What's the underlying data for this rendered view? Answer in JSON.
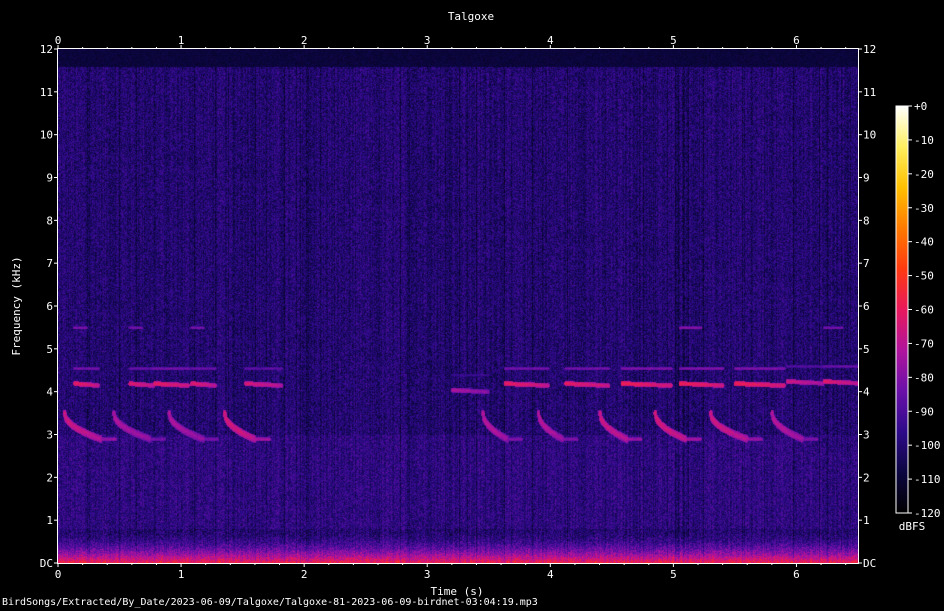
{
  "chart_data": {
    "type": "heatmap",
    "title": "Talgoxe",
    "xlabel": "Time (s)",
    "ylabel": "Frequency (kHz)",
    "xlim": [
      0,
      6.5
    ],
    "ylim": [
      0,
      12
    ],
    "x_ticks": [
      "0",
      "1",
      "2",
      "3",
      "4",
      "5",
      "6"
    ],
    "y_ticks": [
      "DC",
      "1",
      "2",
      "3",
      "4",
      "5",
      "6",
      "7",
      "8",
      "9",
      "10",
      "11",
      "12"
    ],
    "colorbar": {
      "label": "dBFS",
      "range": [
        -120,
        0
      ],
      "ticks": [
        "+0",
        "-10",
        "-20",
        "-30",
        "-40",
        "-50",
        "-60",
        "-70",
        "-80",
        "-90",
        "-100",
        "-110",
        "-120"
      ],
      "colors": [
        "#000000",
        "#0b0640",
        "#2e0a8a",
        "#6a10a8",
        "#b0149c",
        "#e8195c",
        "#ff3a10",
        "#ff7a00",
        "#ffc000",
        "#ffef60",
        "#ffffff"
      ]
    },
    "background_db": -100,
    "noise_floor_db": -112,
    "low_freq_band": {
      "top_khz": 0.8,
      "peak_db": -55
    },
    "cutoff_khz": 11.6,
    "tones": [
      {
        "t": 0.13,
        "f": 4.2,
        "dur": 0.2,
        "db": -60,
        "upper": 5.5
      },
      {
        "t": 0.58,
        "f": 4.2,
        "dur": 0.2,
        "db": -62,
        "upper": 5.5
      },
      {
        "t": 0.78,
        "f": 4.2,
        "dur": 0.28,
        "db": -60
      },
      {
        "t": 1.08,
        "f": 4.2,
        "dur": 0.2,
        "db": -62,
        "upper": 5.5
      },
      {
        "t": 1.52,
        "f": 4.2,
        "dur": 0.3,
        "db": -64
      },
      {
        "t": 3.2,
        "f": 4.05,
        "dur": 0.3,
        "db": -72
      },
      {
        "t": 3.63,
        "f": 4.2,
        "dur": 0.35,
        "db": -60
      },
      {
        "t": 4.12,
        "f": 4.2,
        "dur": 0.35,
        "db": -60
      },
      {
        "t": 4.58,
        "f": 4.2,
        "dur": 0.4,
        "db": -58
      },
      {
        "t": 5.05,
        "f": 4.2,
        "dur": 0.35,
        "db": -58,
        "upper": 5.5
      },
      {
        "t": 5.5,
        "f": 4.2,
        "dur": 0.4,
        "db": -58
      },
      {
        "t": 5.92,
        "f": 4.25,
        "dur": 0.3,
        "db": -66
      },
      {
        "t": 6.22,
        "f": 4.25,
        "dur": 0.3,
        "db": -62,
        "upper": 5.5
      }
    ],
    "notes": [
      {
        "t": 0.05,
        "dur": 0.3,
        "db": -66
      },
      {
        "t": 0.45,
        "dur": 0.3,
        "db": -72
      },
      {
        "t": 0.9,
        "dur": 0.28,
        "db": -72
      },
      {
        "t": 1.35,
        "dur": 0.25,
        "db": -64
      },
      {
        "t": 3.45,
        "dur": 0.2,
        "db": -70
      },
      {
        "t": 3.9,
        "dur": 0.2,
        "db": -70
      },
      {
        "t": 4.4,
        "dur": 0.22,
        "db": -66
      },
      {
        "t": 4.85,
        "dur": 0.25,
        "db": -64
      },
      {
        "t": 5.3,
        "dur": 0.3,
        "db": -66
      },
      {
        "t": 5.8,
        "dur": 0.25,
        "db": -70
      }
    ]
  },
  "footer": {
    "filepath": "BirdSongs/Extracted/By_Date/2023-06-09/Talgoxe/Talgoxe-81-2023-06-09-birdnet-03:04:19.mp3"
  }
}
